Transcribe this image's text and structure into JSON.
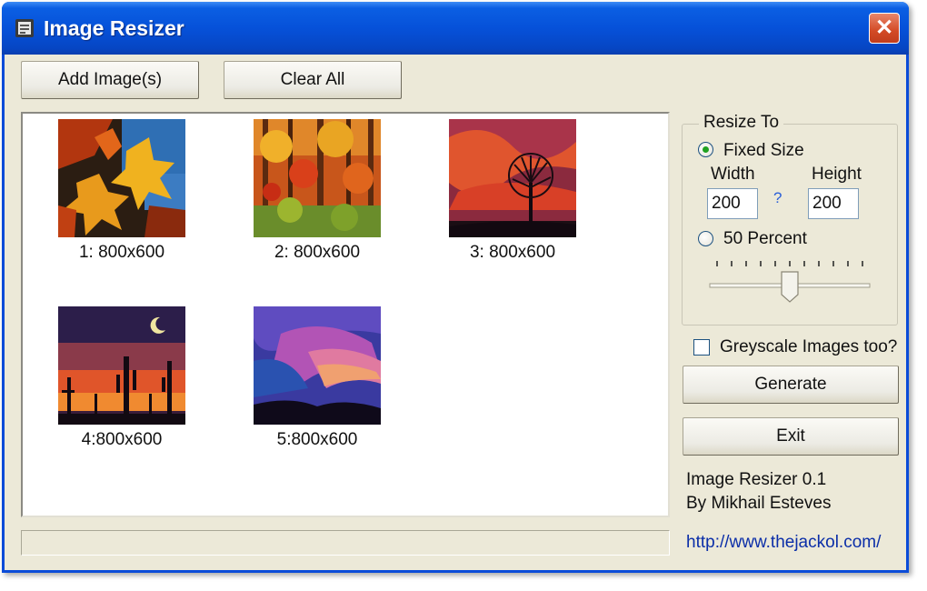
{
  "window": {
    "title": "Image Resizer",
    "close_glyph": "✕"
  },
  "toolbar": {
    "add_images_label": "Add Image(s)",
    "clear_all_label": "Clear All"
  },
  "images": [
    {
      "label": "1: 800x600",
      "icon": "autumn-leaves-thumbnail"
    },
    {
      "label": "2: 800x600",
      "icon": "autumn-forest-thumbnail"
    },
    {
      "label": "3: 800x600",
      "icon": "sunset-tree-thumbnail"
    },
    {
      "label": "4:800x600",
      "icon": "desert-cactus-sunset-thumbnail"
    },
    {
      "label": "5:800x600",
      "icon": "purple-sky-thumbnail"
    }
  ],
  "resize": {
    "group_label": "Resize To",
    "fixed_size_label": "Fixed Size",
    "fixed_size_selected": true,
    "width_label": "Width",
    "height_label": "Height",
    "width_value": "200",
    "height_value": "200",
    "link_symbol": "?",
    "percent_label": "50 Percent",
    "percent_selected": false,
    "slider_ticks": 11,
    "slider_position_fraction": 0.5
  },
  "options": {
    "greyscale_label": "Greyscale Images too?",
    "greyscale_checked": false
  },
  "actions": {
    "generate_label": "Generate",
    "exit_label": "Exit"
  },
  "about": {
    "version": "Image Resizer 0.1",
    "author": "By Mikhail Esteves",
    "url": "http://www.thejackol.com/"
  },
  "colors": {
    "titlebar": "#0651d9",
    "close_button": "#d34a25",
    "link": "#0b2ea8",
    "radio_dot": "#21a121"
  }
}
